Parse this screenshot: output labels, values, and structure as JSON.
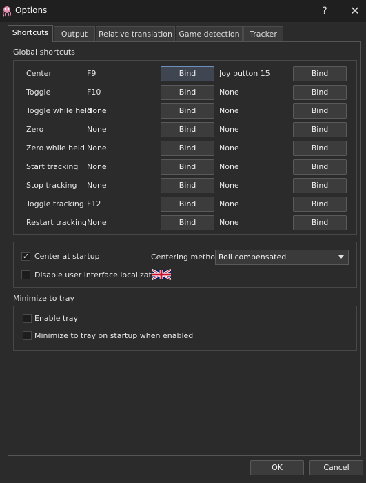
{
  "window": {
    "title": "Options",
    "help_glyph": "?",
    "close_glyph": "✕"
  },
  "tabs": [
    {
      "label": "Shortcuts"
    },
    {
      "label": "Output"
    },
    {
      "label": "Relative translation"
    },
    {
      "label": "Game detection"
    },
    {
      "label": "Tracker"
    }
  ],
  "global_shortcuts": {
    "title": "Global shortcuts",
    "rows": [
      {
        "label": "Center",
        "key": "F9",
        "button1": "Bind",
        "joy": "Joy button 15",
        "button2": "Bind"
      },
      {
        "label": "Toggle",
        "key": "F10",
        "button1": "Bind",
        "joy": "None",
        "button2": "Bind"
      },
      {
        "label": "Toggle while held",
        "key": "None",
        "button1": "Bind",
        "joy": "None",
        "button2": "Bind"
      },
      {
        "label": "Zero",
        "key": "None",
        "button1": "Bind",
        "joy": "None",
        "button2": "Bind"
      },
      {
        "label": "Zero while held",
        "key": "None",
        "button1": "Bind",
        "joy": "None",
        "button2": "Bind"
      },
      {
        "label": "Start tracking",
        "key": "None",
        "button1": "Bind",
        "joy": "None",
        "button2": "Bind"
      },
      {
        "label": "Stop tracking",
        "key": "None",
        "button1": "Bind",
        "joy": "None",
        "button2": "Bind"
      },
      {
        "label": "Toggle tracking",
        "key": "F12",
        "button1": "Bind",
        "joy": "None",
        "button2": "Bind"
      },
      {
        "label": "Restart tracking",
        "key": "None",
        "button1": "Bind",
        "joy": "None",
        "button2": "Bind"
      }
    ]
  },
  "startup": {
    "center_at_startup": {
      "label": "Center at startup",
      "checked": true,
      "mark": "✓"
    },
    "centering_method": {
      "label": "Centering method",
      "value": "Roll compensated"
    },
    "disable_localization": {
      "label": "Disable user interface localization",
      "checked": false
    }
  },
  "tray": {
    "title": "Minimize to tray",
    "enable_tray": {
      "label": "Enable tray",
      "checked": false
    },
    "minimize_on_startup": {
      "label": "Minimize to tray on startup when enabled",
      "checked": false
    }
  },
  "dialog_buttons": {
    "ok": "OK",
    "cancel": "Cancel"
  },
  "colors": {
    "background": "#2b2b2b",
    "titlebar": "#1f1f1f",
    "focus_border": "#6f8fbf"
  }
}
